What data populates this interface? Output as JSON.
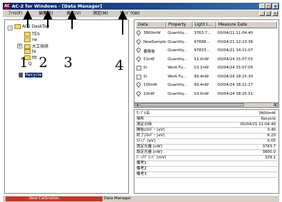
{
  "window": {
    "icon_label": "AC",
    "title": "AC-2 for Windows - [Data Manager]",
    "min_label": "_",
    "max_label": "□",
    "close_label": "×"
  },
  "menu": {
    "items": [
      "ﾌｧｲﾙ(F)",
      "編集(E)",
      "表示(V)",
      "測定(M)",
      "ｳｨﾝﾄﾞｳ(W)"
    ],
    "mdi_buttons": [
      "_",
      "□",
      "×"
    ]
  },
  "tree": {
    "root": "AC2 DeskTop",
    "children": [
      "TES",
      "ne",
      "大工技研",
      "te",
      "ttt",
      "Q"
    ],
    "recycle": "Recycle"
  },
  "list": {
    "columns": [
      "Data",
      "Property",
      "Light I...",
      "Measure Date"
    ],
    "rows": [
      {
        "icon": "bulb",
        "name": "3800mW",
        "property": "Quantity...",
        "light": "3763.7...",
        "date": "00/04/21 11:04:40"
      },
      {
        "icon": "bulb",
        "name": "NewSample",
        "property": "Quantity...",
        "light": "97668...",
        "date": "00/04/21 12:13:36"
      },
      {
        "icon": "bulb",
        "name": "書換後",
        "property": "Quantity...",
        "light": "97833...",
        "date": "00/04/21 14:11:07"
      },
      {
        "icon": "bulb",
        "name": "51nW",
        "property": "Quantity...",
        "light": "51.0nW",
        "date": "00/04/24 15:07:01"
      },
      {
        "icon": "si",
        "name": "Si",
        "property": "Work Fu...",
        "light": "10.1nW",
        "date": "00/04/24 15:07:05"
      },
      {
        "icon": "si",
        "name": "Si",
        "property": "Work Fu...",
        "light": "99.4nW",
        "date": "00/04/24 18:15:30"
      },
      {
        "icon": "bulb",
        "name": "100nW",
        "property": "Quantity...",
        "light": "99.4nW",
        "date": "00/04/24 18:21:17"
      },
      {
        "icon": "bulb",
        "name": "10nW",
        "property": "Quantity...",
        "light": "10.0nW",
        "date": "00/04/24 18:25:51"
      }
    ]
  },
  "properties": [
    {
      "name": "ｻﾝﾌﾟﾙ名",
      "value": "3800mW"
    },
    {
      "name": "場所",
      "value": "Recycle"
    },
    {
      "name": "測定日時",
      "value": "00/04/21 11:04:40"
    },
    {
      "name": "開始ｴﾈﾙｷﾞｰ [eV]",
      "value": "3.40"
    },
    {
      "name": "終了ｴﾈﾙｷﾞｰ [eV]",
      "value": "6.20"
    },
    {
      "name": "ｽﾃｯﾌﾟ [eV]",
      "value": "0.05"
    },
    {
      "name": "測定光量 [nW]",
      "value": "3763.7"
    },
    {
      "name": "設定光量 [nW]",
      "value": "3800.0"
    },
    {
      "name": "ﾊﾞｯｸｸﾞﾗﾝﾄﾞ [mV]",
      "value": "329.1"
    },
    {
      "name": "備考1",
      "value": ""
    },
    {
      "name": "備考2",
      "value": ""
    },
    {
      "name": "備考3",
      "value": ""
    }
  ],
  "status": {
    "left": "New Calibration",
    "right": "Data Manager"
  },
  "annotations": [
    "1",
    "2",
    "3",
    "4"
  ],
  "colors": {
    "titlebar": "#0a246a",
    "face": "#d4d0c8",
    "status_left": "#c0392b"
  }
}
